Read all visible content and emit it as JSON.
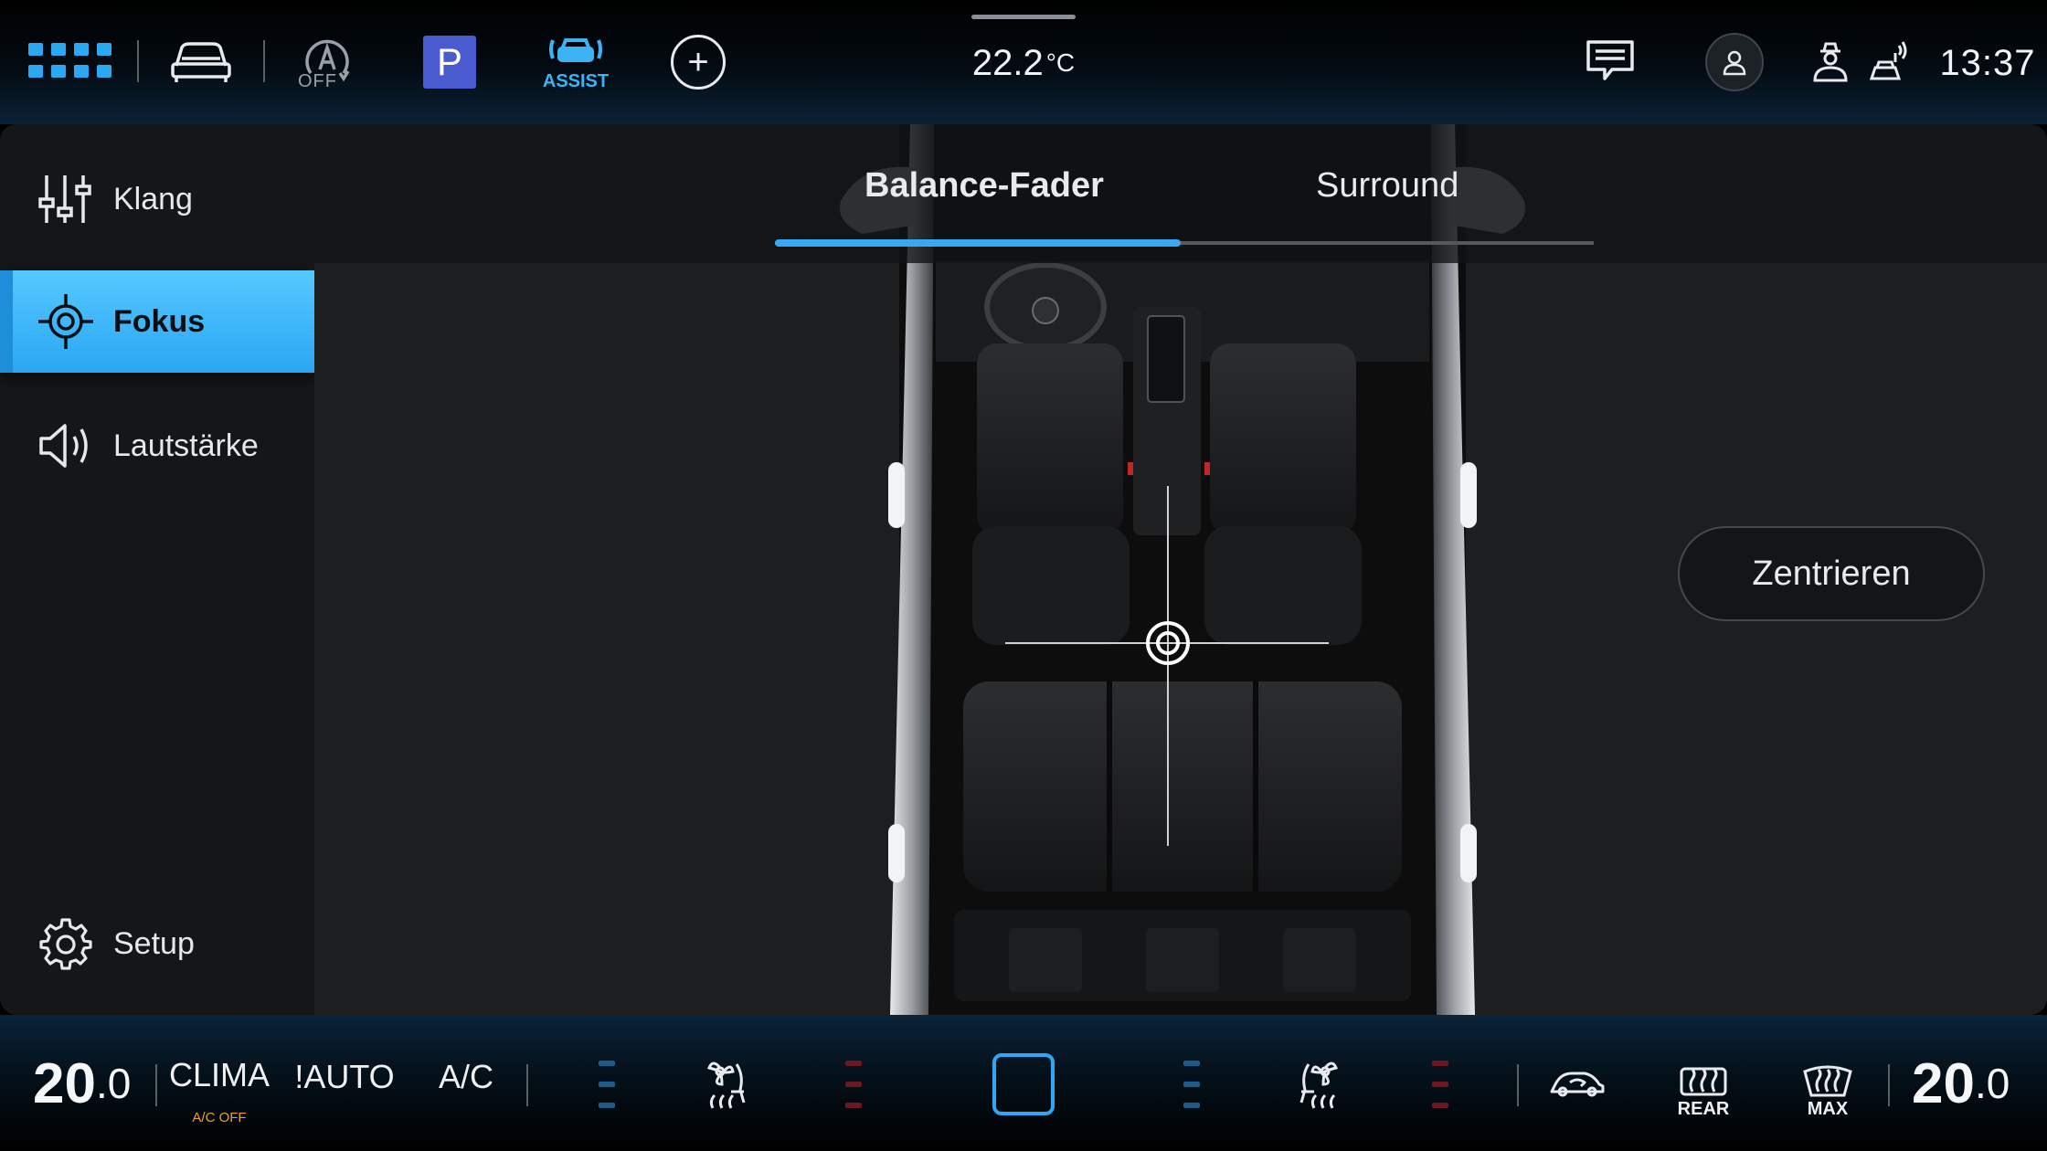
{
  "status_bar": {
    "autohold_label": "OFF",
    "park_label": "P",
    "assist_label": "ASSIST",
    "plus_label": "+",
    "outside_temp": "22.2",
    "temp_unit": "°C",
    "clock": "13:37"
  },
  "sidebar": {
    "items": [
      {
        "label": "Klang",
        "icon": "equalizer-sliders-icon",
        "active": false
      },
      {
        "label": "Fokus",
        "icon": "focus-target-icon",
        "active": true
      },
      {
        "label": "Lautstärke",
        "icon": "speaker-volume-icon",
        "active": false
      }
    ],
    "setup": {
      "label": "Setup",
      "icon": "gear-icon"
    }
  },
  "main": {
    "tabs": [
      {
        "label": "Balance-Fader",
        "active": true
      },
      {
        "label": "Surround",
        "active": false
      }
    ],
    "center_button": "Zentrieren"
  },
  "climate": {
    "left_temp_int": "20",
    "left_temp_dec": ".0",
    "clima_label": "CLIMA",
    "ac_off_label": "A/C OFF",
    "auto_label": "!AUTO",
    "ac_label": "A/C",
    "rear_label": "REAR",
    "max_label": "MAX",
    "right_temp_int": "20",
    "right_temp_dec": ".0"
  },
  "colors": {
    "accent_blue": "#2ea8f4",
    "active_tab_bg": "#3fb6fb",
    "ac_off_orange": "#f0a020",
    "park_button": "#4a5bd0"
  }
}
